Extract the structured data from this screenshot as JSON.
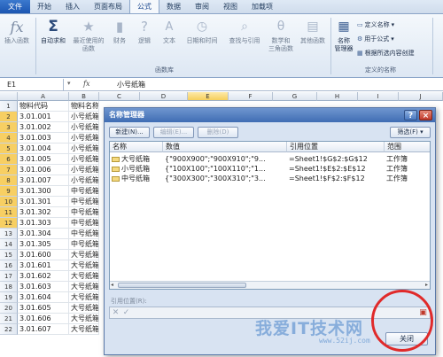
{
  "ribbon": {
    "tabs": [
      "文件",
      "开始",
      "插入",
      "页面布局",
      "公式",
      "数据",
      "审阅",
      "视图",
      "加载项"
    ],
    "active_tab": "公式",
    "buttons": [
      "插入函数",
      "自动求和",
      "最近使用的\n函数",
      "财务",
      "逻辑",
      "文本",
      "日期和时间",
      "查找与引用",
      "数学和\n三角函数",
      "其他函数",
      "名称\n管理器"
    ],
    "function_library_label": "函数库",
    "defined_names_label": "定义的名称",
    "define_name": "定义名称",
    "use_in_formula": "用于公式",
    "create_from_selection": "根据所选内容创建"
  },
  "formula_bar": {
    "name_box": "E1",
    "fx": "fx",
    "content": "小号纸箱"
  },
  "grid": {
    "columns": [
      "A",
      "B",
      "C",
      "D",
      "E",
      "F",
      "G",
      "H",
      "I",
      "J"
    ],
    "rows": [
      {
        "n": "1",
        "a": "物料代码",
        "b": "物料名称"
      },
      {
        "n": "2",
        "a": "3.01.001",
        "b": "小号纸箱"
      },
      {
        "n": "3",
        "a": "3.01.002",
        "b": "小号纸箱"
      },
      {
        "n": "4",
        "a": "3.01.003",
        "b": "小号纸箱"
      },
      {
        "n": "5",
        "a": "3.01.004",
        "b": "小号纸箱"
      },
      {
        "n": "6",
        "a": "3.01.005",
        "b": "小号纸箱"
      },
      {
        "n": "7",
        "a": "3.01.006",
        "b": "小号纸箱"
      },
      {
        "n": "8",
        "a": "3.01.007",
        "b": "小号纸箱"
      },
      {
        "n": "9",
        "a": "3.01.300",
        "b": "中号纸箱"
      },
      {
        "n": "10",
        "a": "3.01.301",
        "b": "中号纸箱"
      },
      {
        "n": "11",
        "a": "3.01.302",
        "b": "中号纸箱"
      },
      {
        "n": "12",
        "a": "3.01.303",
        "b": "中号纸箱"
      },
      {
        "n": "13",
        "a": "3.01.304",
        "b": "中号纸箱"
      },
      {
        "n": "14",
        "a": "3.01.305",
        "b": "中号纸箱"
      },
      {
        "n": "15",
        "a": "3.01.600",
        "b": "大号纸箱"
      },
      {
        "n": "16",
        "a": "3.01.601",
        "b": "大号纸箱"
      },
      {
        "n": "17",
        "a": "3.01.602",
        "b": "大号纸箱"
      },
      {
        "n": "18",
        "a": "3.01.603",
        "b": "大号纸箱"
      },
      {
        "n": "19",
        "a": "3.01.604",
        "b": "大号纸箱"
      },
      {
        "n": "20",
        "a": "3.01.605",
        "b": "大号纸箱"
      },
      {
        "n": "21",
        "a": "3.01.606",
        "b": "大号纸箱"
      },
      {
        "n": "22",
        "a": "3.01.607",
        "b": "大号纸箱"
      }
    ]
  },
  "dialog": {
    "title": "名称管理器",
    "help": "?",
    "close": "×",
    "new_button": "新建(N)...",
    "edit_button": "编辑(E)...",
    "delete_button": "删除(D)",
    "filter_button": "筛选(F) ▾",
    "headers": [
      "名称",
      "数值",
      "引用位置",
      "范围"
    ],
    "entries": [
      {
        "name": "大号纸箱",
        "value": "{\"900X900\";\"900X910\";\"9...",
        "ref": "=Sheet1!$G$2:$G$12",
        "scope": "工作簿"
      },
      {
        "name": "小号纸箱",
        "value": "{\"100X100\";\"100X110\";\"1...",
        "ref": "=Sheet1!$E$2:$E$12",
        "scope": "工作簿"
      },
      {
        "name": "中号纸箱",
        "value": "{\"300X300\";\"300X310\";\"3...",
        "ref": "=Sheet1!$F$2:$F$12",
        "scope": "工作簿"
      }
    ],
    "ref_label": "引用位置(R):",
    "close_button": "关闭"
  },
  "watermark": {
    "main": "我爱IT技术网",
    "sub": "www.52ij.com"
  }
}
